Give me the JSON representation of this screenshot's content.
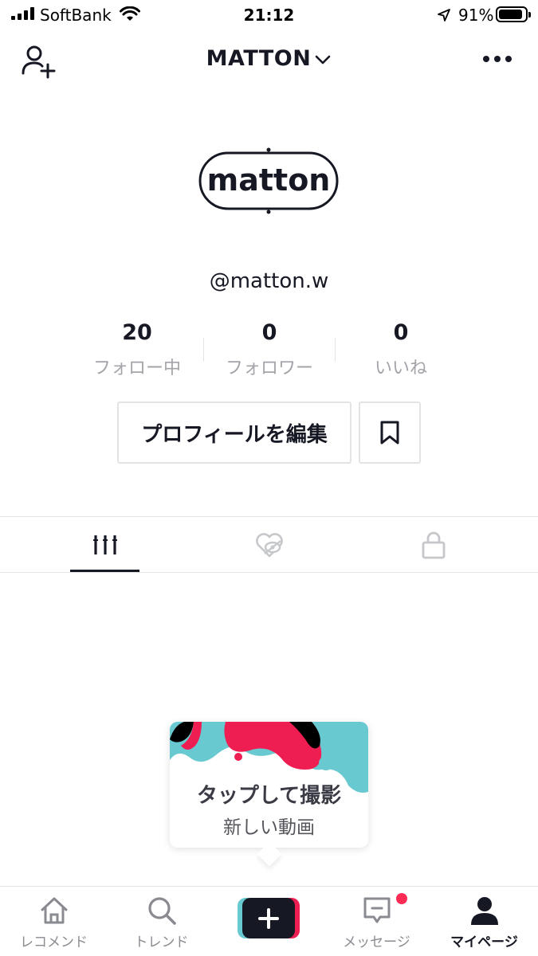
{
  "status_bar": {
    "carrier": "SoftBank",
    "time": "21:12",
    "battery_percent": "91%",
    "battery_level": 0.91
  },
  "header": {
    "title": "MATTON",
    "add_user_icon": "person-plus-icon",
    "more_icon": "ellipsis-icon"
  },
  "profile": {
    "avatar_text": "matton",
    "handle": "@matton.w"
  },
  "stats": [
    {
      "value": "20",
      "label": "フォロー中"
    },
    {
      "value": "0",
      "label": "フォロワー"
    },
    {
      "value": "0",
      "label": "いいね"
    }
  ],
  "actions": {
    "edit_profile": "プロフィールを編集",
    "bookmark_icon": "bookmark-icon"
  },
  "tabs": [
    {
      "icon": "grid-icon",
      "active": true
    },
    {
      "icon": "hidden-liked-icon",
      "active": false
    },
    {
      "icon": "lock-icon",
      "active": false
    }
  ],
  "capture_prompt": {
    "title": "タップして撮影",
    "subtitle": "新しい動画"
  },
  "bottom_nav": [
    {
      "label": "レコメンド",
      "icon": "home-icon"
    },
    {
      "label": "トレンド",
      "icon": "search-icon"
    },
    {
      "label": "",
      "icon": "plus-icon"
    },
    {
      "label": "メッセージ",
      "icon": "message-icon",
      "badge": true
    },
    {
      "label": "マイページ",
      "icon": "person-icon",
      "active": true
    }
  ],
  "colors": {
    "primary_text": "#161823",
    "secondary_text": "#a3a4a9",
    "border": "#e3e3e4",
    "accent_red": "#fe2c55",
    "accent_cyan": "#69c9d0"
  }
}
